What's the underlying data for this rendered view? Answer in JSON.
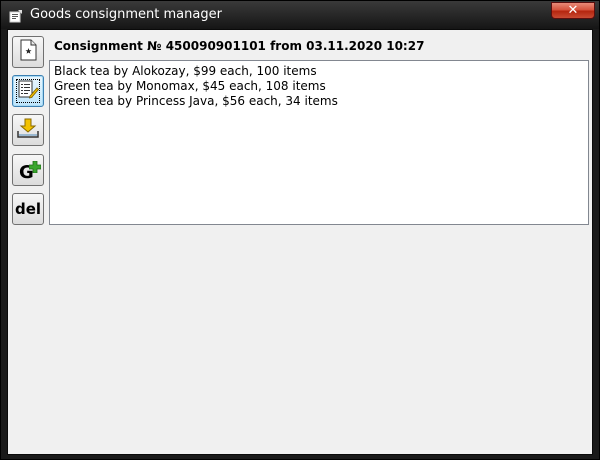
{
  "window": {
    "title": "Goods consignment manager",
    "close_glyph": "✕",
    "icons": {
      "app": "app-icon",
      "close": "close-icon"
    }
  },
  "toolbar": {
    "buttons": [
      {
        "name": "new-document-button",
        "icon": "new-document-icon"
      },
      {
        "name": "edit-document-button",
        "icon": "edit-document-icon",
        "focused": true
      },
      {
        "name": "save-download-button",
        "icon": "download-tray-icon"
      },
      {
        "name": "add-goods-button",
        "label": "G",
        "icon": "plus-icon"
      },
      {
        "name": "delete-button",
        "label": "del"
      }
    ]
  },
  "consignment": {
    "heading": "Consignment № 450090901101 from 03.11.2020 10:27",
    "items": [
      "Black tea by Alokozay, $99 each, 100 items",
      "Green tea by Monomax, $45 each, 108 items",
      "Green tea by Princess Java, $56 each, 34 items"
    ]
  },
  "colors": {
    "titlebar": "#1a1a1a",
    "client_bg": "#f0f0f0",
    "close_button": "#c84a32",
    "focus_accent": "#3c7fb1",
    "plus_green": "#3aa62e",
    "download_yellow": "#f2c200"
  }
}
